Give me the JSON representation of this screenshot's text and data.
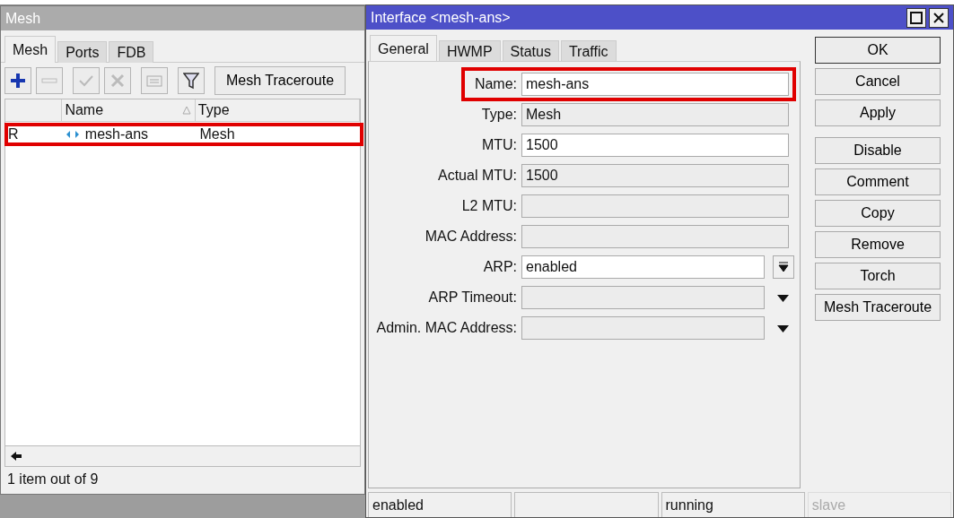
{
  "mesh_window": {
    "title": "Mesh",
    "tabs": [
      {
        "label": "Mesh",
        "selected": true
      },
      {
        "label": "Ports",
        "selected": false
      },
      {
        "label": "FDB",
        "selected": false
      }
    ],
    "toolbar": {
      "button": "Mesh Traceroute"
    },
    "table": {
      "columns": [
        "Name",
        "Type"
      ],
      "rows": [
        {
          "flag": "R",
          "name": "mesh-ans",
          "type": "Mesh",
          "highlighted": true
        }
      ]
    },
    "status": "1 item out of 9"
  },
  "interface_dialog": {
    "title": "Interface <mesh-ans>",
    "tabs": [
      {
        "label": "General",
        "selected": true
      },
      {
        "label": "HWMP",
        "selected": false
      },
      {
        "label": "Status",
        "selected": false
      },
      {
        "label": "Traffic",
        "selected": false
      }
    ],
    "fields": [
      {
        "label": "Name:",
        "value": "mesh-ans",
        "kind": "text",
        "highlighted": true
      },
      {
        "label": "Type:",
        "value": "Mesh",
        "kind": "readonly",
        "highlighted": false
      },
      {
        "label": "MTU:",
        "value": "1500",
        "kind": "text",
        "highlighted": false
      },
      {
        "label": "Actual MTU:",
        "value": "1500",
        "kind": "readonly",
        "highlighted": false
      },
      {
        "label": "L2 MTU:",
        "kind": "readonly",
        "highlighted": false
      },
      {
        "label": "MAC Address:",
        "kind": "readonly",
        "highlighted": false
      },
      {
        "label": "ARP:",
        "value": "enabled",
        "kind": "dropdown",
        "highlighted": false
      },
      {
        "label": "ARP Timeout:",
        "kind": "combo",
        "highlighted": false
      },
      {
        "label": "Admin. MAC Address:",
        "kind": "combo",
        "highlighted": false
      }
    ],
    "buttons": [
      "OK",
      "Cancel",
      "Apply"
    ],
    "action_buttons": [
      "Disable",
      "Comment",
      "Copy",
      "Remove",
      "Torch",
      "Mesh Traceroute"
    ],
    "status_bar": [
      {
        "text": "enabled",
        "disabled": false
      },
      {
        "disabled": false
      },
      {
        "text": "running",
        "disabled": false
      },
      {
        "text": "slave",
        "disabled": true
      }
    ]
  }
}
